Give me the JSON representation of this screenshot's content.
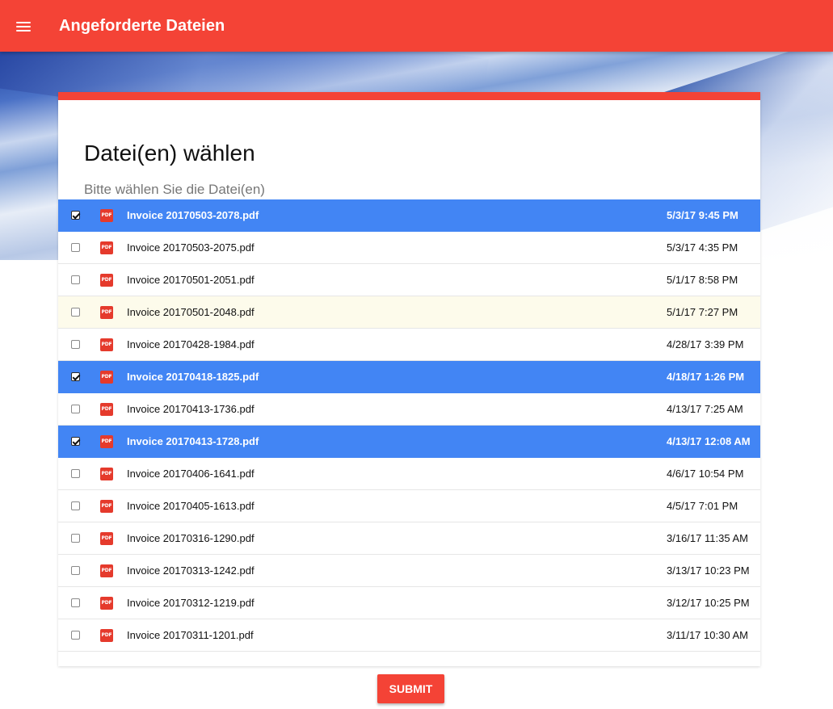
{
  "appbar": {
    "title": "Angeforderte Dateien"
  },
  "card": {
    "title": "Datei(en) wählen",
    "subtitle": "Bitte wählen Sie die Datei(en)"
  },
  "files": [
    {
      "name": "Invoice 20170503-2078.pdf",
      "date": "5/3/17 9:45 PM",
      "selected": true,
      "hover": false
    },
    {
      "name": "Invoice 20170503-2075.pdf",
      "date": "5/3/17 4:35 PM",
      "selected": false,
      "hover": false
    },
    {
      "name": "Invoice 20170501-2051.pdf",
      "date": "5/1/17 8:58 PM",
      "selected": false,
      "hover": false
    },
    {
      "name": "Invoice 20170501-2048.pdf",
      "date": "5/1/17 7:27 PM",
      "selected": false,
      "hover": true
    },
    {
      "name": "Invoice 20170428-1984.pdf",
      "date": "4/28/17 3:39 PM",
      "selected": false,
      "hover": false
    },
    {
      "name": "Invoice 20170418-1825.pdf",
      "date": "4/18/17 1:26 PM",
      "selected": true,
      "hover": false
    },
    {
      "name": "Invoice 20170413-1736.pdf",
      "date": "4/13/17 7:25 AM",
      "selected": false,
      "hover": false
    },
    {
      "name": "Invoice 20170413-1728.pdf",
      "date": "4/13/17 12:08 AM",
      "selected": true,
      "hover": false
    },
    {
      "name": "Invoice 20170406-1641.pdf",
      "date": "4/6/17 10:54 PM",
      "selected": false,
      "hover": false
    },
    {
      "name": "Invoice 20170405-1613.pdf",
      "date": "4/5/17 7:01 PM",
      "selected": false,
      "hover": false
    },
    {
      "name": "Invoice 20170316-1290.pdf",
      "date": "3/16/17 11:35 AM",
      "selected": false,
      "hover": false
    },
    {
      "name": "Invoice 20170313-1242.pdf",
      "date": "3/13/17 10:23 PM",
      "selected": false,
      "hover": false
    },
    {
      "name": "Invoice 20170312-1219.pdf",
      "date": "3/12/17 10:25 PM",
      "selected": false,
      "hover": false
    },
    {
      "name": "Invoice 20170311-1201.pdf",
      "date": "3/11/17 10:30 AM",
      "selected": false,
      "hover": false
    }
  ],
  "file_icon": {
    "icon": "pdf-icon",
    "label": "PDF"
  },
  "submit_label": "SUBMIT",
  "colors": {
    "primary": "#f44336",
    "selected_row": "#4285f4",
    "hover_row": "#fdfbeb"
  }
}
